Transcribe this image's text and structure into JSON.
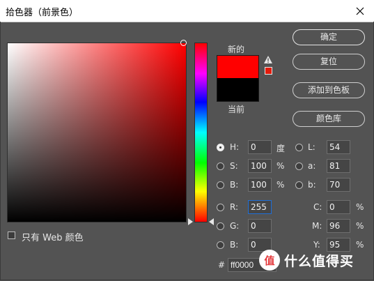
{
  "window": {
    "title": "拾色器（前景色）"
  },
  "preview": {
    "new_label": "新的",
    "current_label": "当前",
    "new_color": "#ff0000",
    "current_color": "#000000",
    "gamut_color": "#e31b0c"
  },
  "buttons": {
    "ok": "确定",
    "reset": "复位",
    "add_swatch": "添加到色板",
    "libraries": "颜色库"
  },
  "webonly": {
    "label": "只有 Web 颜色",
    "checked": false
  },
  "hsb": {
    "h": {
      "label": "H:",
      "value": "0",
      "unit": "度",
      "selected": true
    },
    "s": {
      "label": "S:",
      "value": "100",
      "unit": "%"
    },
    "b": {
      "label": "B:",
      "value": "100",
      "unit": "%"
    }
  },
  "rgb": {
    "r": {
      "label": "R:",
      "value": "255"
    },
    "g": {
      "label": "G:",
      "value": "0"
    },
    "b": {
      "label": "B:",
      "value": "0"
    }
  },
  "lab": {
    "l": {
      "label": "L:",
      "value": "54"
    },
    "a": {
      "label": "a:",
      "value": "81"
    },
    "b": {
      "label": "b:",
      "value": "70"
    }
  },
  "cmyk": {
    "c": {
      "label": "C:",
      "value": "0",
      "unit": "%"
    },
    "m": {
      "label": "M:",
      "value": "96",
      "unit": "%"
    },
    "y": {
      "label": "Y:",
      "value": "95",
      "unit": "%"
    }
  },
  "hex": {
    "label": "#",
    "value": "ff0000"
  },
  "watermark": {
    "text": "什么值得买",
    "logo_char": "值"
  }
}
